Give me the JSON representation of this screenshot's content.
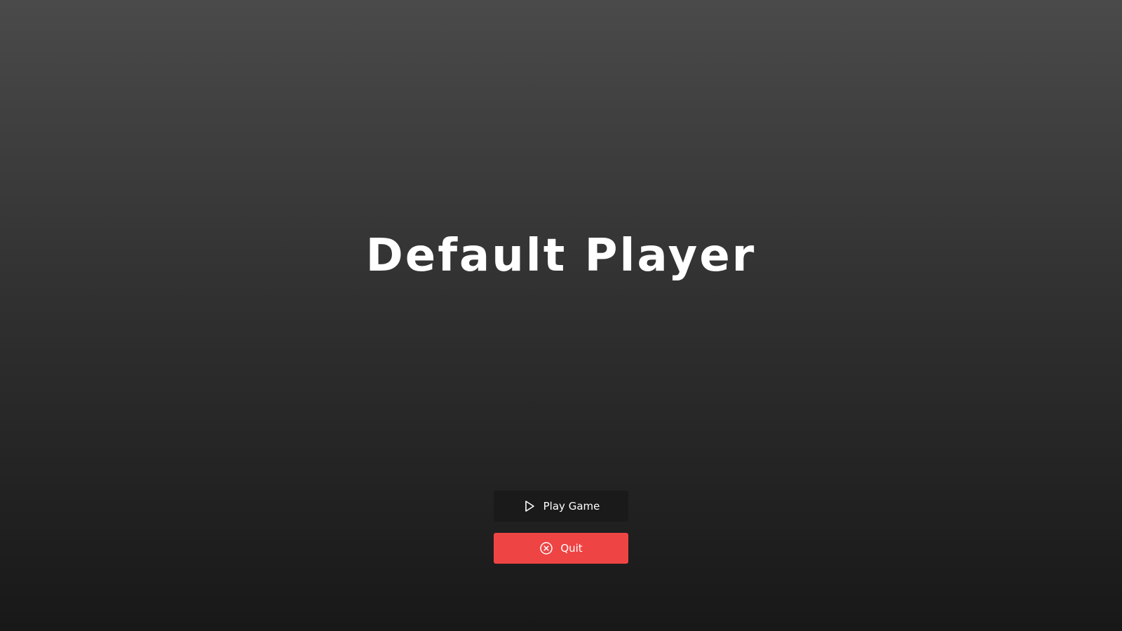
{
  "title": "Default Player",
  "menu": {
    "play_label": "Play Game",
    "play_icon": "play-icon",
    "quit_label": "Quit",
    "quit_icon": "close-circle-icon"
  },
  "colors": {
    "quit_button": "#ef4444",
    "play_button": "#1a1a1a",
    "text": "#ffffff"
  }
}
